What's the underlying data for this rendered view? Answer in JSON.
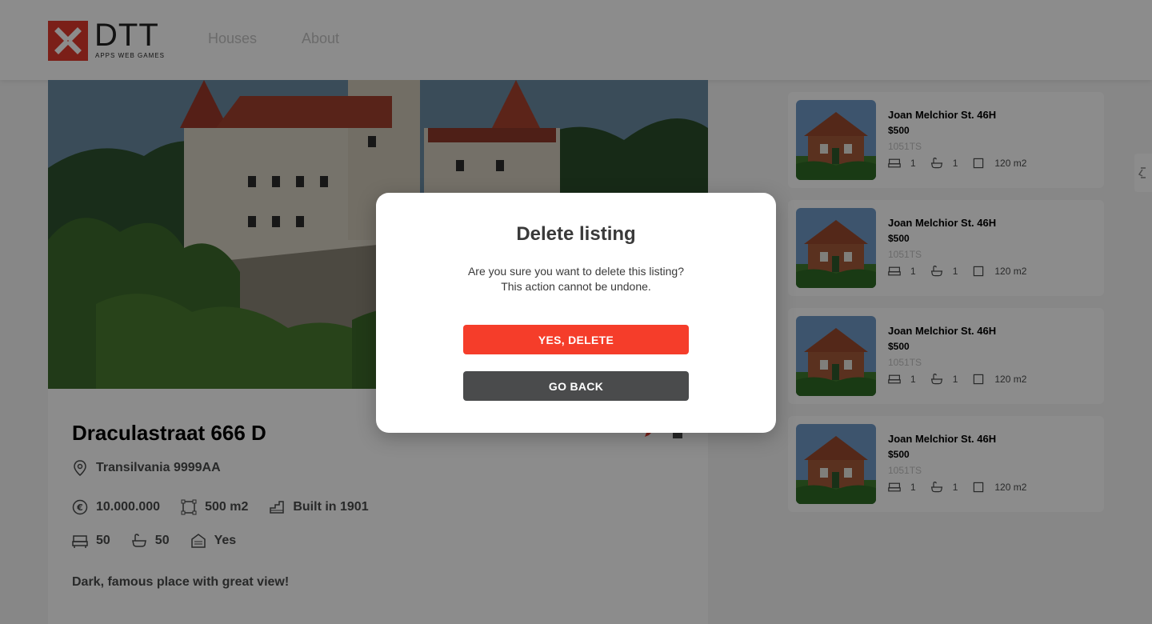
{
  "header": {
    "logo_text": "DTT",
    "logo_sub": "APPS WEB GAMES",
    "nav": [
      "Houses",
      "About"
    ]
  },
  "listing": {
    "title": "Draculastraat 666 D",
    "location": "Transilvania 9999AA",
    "price": "10.000.000",
    "size": "500 m2",
    "built": "Built in 1901",
    "bedrooms": "50",
    "bathrooms": "50",
    "garage": "Yes",
    "description": "Dark, famous place with great view!"
  },
  "recommended": [
    {
      "title": "Joan Melchior St. 46H",
      "price": "$500",
      "zip": "1051TS",
      "beds": "1",
      "baths": "1",
      "size": "120 m2"
    },
    {
      "title": "Joan Melchior St. 46H",
      "price": "$500",
      "zip": "1051TS",
      "beds": "1",
      "baths": "1",
      "size": "120 m2"
    },
    {
      "title": "Joan Melchior St. 46H",
      "price": "$500",
      "zip": "1051TS",
      "beds": "1",
      "baths": "1",
      "size": "120 m2"
    },
    {
      "title": "Joan Melchior St. 46H",
      "price": "$500",
      "zip": "1051TS",
      "beds": "1",
      "baths": "1",
      "size": "120 m2"
    }
  ],
  "modal": {
    "title": "Delete listing",
    "text_line1": "Are you sure you want to delete this listing?",
    "text_line2": "This action cannot be undone.",
    "confirm_label": "YES, DELETE",
    "cancel_label": "GO BACK"
  },
  "colors": {
    "accent": "#f53d2a",
    "dark_button": "#4a4b4c",
    "logo_red": "#e03a2d"
  }
}
